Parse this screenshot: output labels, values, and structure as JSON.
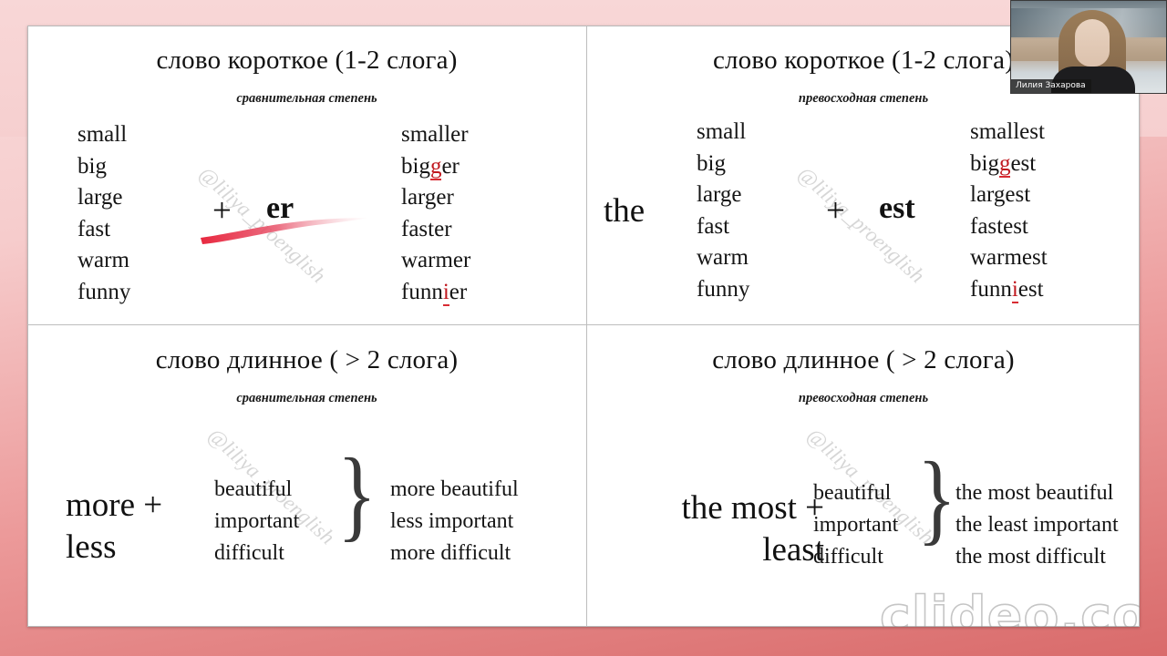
{
  "frame": {
    "top_color": "#f6cfcf",
    "bottom_color": "#d96b6b"
  },
  "slide": {
    "quadrants": [
      {
        "id": "short-comparative",
        "title": "слово короткое (1-2 слога)",
        "subtitle": "сравнительная степень",
        "base_words": [
          "small",
          "big",
          "large",
          "fast",
          "warm",
          "funny"
        ],
        "formula_plus": "+",
        "formula_suffix": "er",
        "results": [
          {
            "pre": "smaller",
            "hi": "",
            "post": ""
          },
          {
            "pre": "big",
            "hi": "g",
            "post": "er"
          },
          {
            "pre": "larger",
            "hi": "",
            "post": ""
          },
          {
            "pre": "faster",
            "hi": "",
            "post": ""
          },
          {
            "pre": "warmer",
            "hi": "",
            "post": ""
          },
          {
            "pre": "funn",
            "hi": "i",
            "post": "er"
          }
        ]
      },
      {
        "id": "short-superlative",
        "title": "слово короткое (1-2 слога)",
        "subtitle": "превосходная степень",
        "article": "the",
        "base_words": [
          "small",
          "big",
          "large",
          "fast",
          "warm",
          "funny"
        ],
        "formula_plus": "+",
        "formula_suffix": "est",
        "results": [
          {
            "pre": "smallest",
            "hi": "",
            "post": ""
          },
          {
            "pre": "big",
            "hi": "g",
            "post": "est"
          },
          {
            "pre": "largest",
            "hi": "",
            "post": ""
          },
          {
            "pre": "fastest",
            "hi": "",
            "post": ""
          },
          {
            "pre": "warmest",
            "hi": "",
            "post": ""
          },
          {
            "pre": "funn",
            "hi": "i",
            "post": "est"
          }
        ]
      },
      {
        "id": "long-comparative",
        "title": "слово длинное ( > 2 слога)",
        "subtitle": "сравнительная степень",
        "modifier_line1": "more +",
        "modifier_line2": "less",
        "base_words": [
          "beautiful",
          "important",
          "difficult"
        ],
        "results": [
          "more beautiful",
          "less important",
          "more difficult"
        ]
      },
      {
        "id": "long-superlative",
        "title": "слово длинное ( > 2 слога)",
        "subtitle": "превосходная степень",
        "modifier_line1": "the most +",
        "modifier_line2": "least",
        "base_words": [
          "beautiful",
          "important",
          "difficult"
        ],
        "results": [
          "the most beautiful",
          "the least important",
          "the most difficult"
        ]
      }
    ],
    "watermark": "@liliya_proenglish",
    "brand_watermark": "clideo.com"
  },
  "webcam": {
    "participant_name": "Лилия Захарова"
  }
}
